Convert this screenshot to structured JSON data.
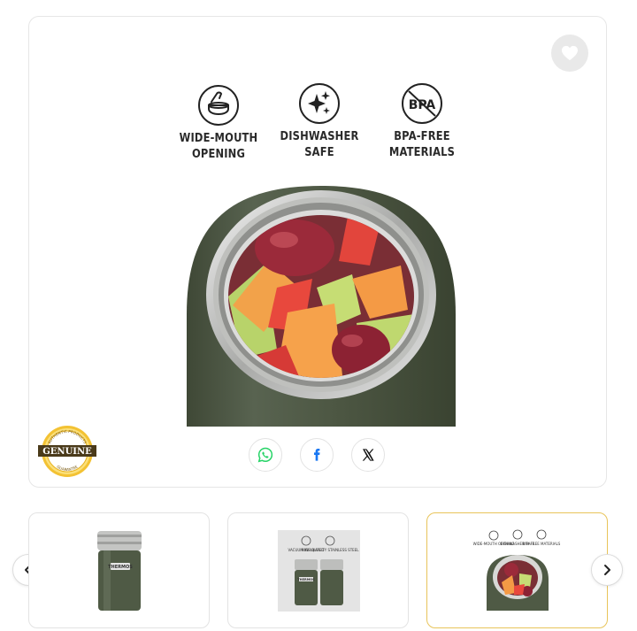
{
  "product_gallery": {
    "features": [
      {
        "icon": "wide-mouth-icon",
        "label": "WIDE-MOUTH\nOPENING"
      },
      {
        "icon": "sparkle-icon",
        "label": "DISHWASHER\nSAFE"
      },
      {
        "icon": "bpa-free-icon",
        "label": "BPA-FREE\nMATERIALS",
        "icon_text": "BPA"
      }
    ],
    "badge": {
      "word": "GENUINE",
      "ring_top": "AUTHENTIC PRODUCTS",
      "ring_bottom": "GUARANTEE"
    },
    "share": [
      "whatsapp-icon",
      "facebook-icon",
      "x-icon"
    ],
    "thumbnails": [
      {
        "name": "thumbnail-flask",
        "brand": "THERMOS",
        "active": false
      },
      {
        "name": "thumbnail-two-flasks",
        "brand": "THERMOS",
        "labels": [
          "VACUUM INSULATED",
          "HIGH QUALITY STAINLESS STEEL"
        ],
        "active": false
      },
      {
        "name": "thumbnail-features",
        "labels": [
          "WIDE-MOUTH OPENING",
          "DISHWASHER SAFE",
          "BPA-FREE MATERIALS"
        ],
        "active": true
      }
    ],
    "colors": {
      "flask_green": "#4f5a45",
      "active_border": "#e8c45a",
      "badge_gold": "#e8b21f",
      "whatsapp": "#25d366",
      "facebook": "#1877f2"
    }
  }
}
